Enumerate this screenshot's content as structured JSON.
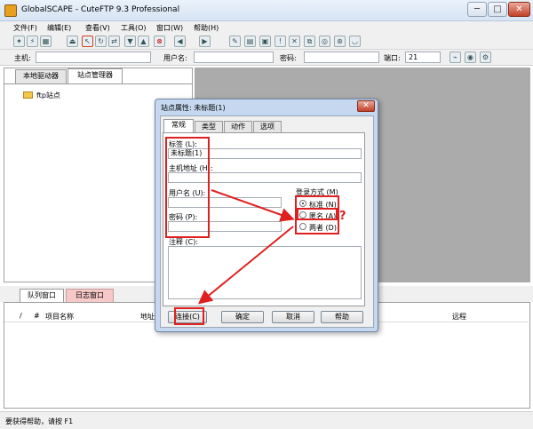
{
  "window": {
    "title": "GlobalSCAPE - CuteFTP 9.3 Professional",
    "minimize": "─",
    "maximize": "□",
    "close": "✕"
  },
  "menu": [
    "文件(F)",
    "编辑(E)",
    "查看(V)",
    "工具(O)",
    "窗口(W)",
    "帮助(H)"
  ],
  "toolbar_icons": [
    "connect-wizard-icon",
    "quick-connect-icon",
    "site-manager-icon",
    "disconnect-icon",
    "folder-icon",
    "select-icon",
    "refresh-icon",
    "reconnect-icon",
    "download-icon",
    "upload-icon",
    "stop-icon",
    "queue-icon",
    "back-icon",
    "forward-icon",
    "edit-icon",
    "view-icon",
    "open-icon",
    "alert-icon",
    "cancel-icon",
    "copy-icon",
    "settings-icon",
    "transfer-icon",
    "help-icon"
  ],
  "quickconnect": {
    "host_label": "主机:",
    "user_label": "用户名:",
    "password_label": "密码:",
    "port_label": "端口:",
    "port_value": "21"
  },
  "left_pane": {
    "tab_local": "本地驱动器",
    "tab_site_manager": "站点管理器",
    "tree_item": "ftp站点"
  },
  "queue": {
    "tab_queue": "队列窗口",
    "tab_log": "日志窗口",
    "columns": [
      "/",
      "#",
      "项目名称",
      "地址",
      "远程"
    ]
  },
  "status": "要获得帮助，请按 F1",
  "dialog": {
    "title": "站点属性: 未标题(1)",
    "close": "✕",
    "tabs": [
      "常规",
      "类型",
      "动作",
      "选项"
    ],
    "label_label": "标签 (L):",
    "label_value": "未标题(1)",
    "host_label": "主机地址 (H):",
    "host_value": "",
    "user_label": "用户名 (U):",
    "user_value": "",
    "password_label": "密码 (P):",
    "password_value": "",
    "login_method_label": "登录方式 (M)",
    "login_options": [
      "标准 (N)",
      "匿名 (A)",
      "两者 (D)"
    ],
    "login_selected": 0,
    "comment_label": "注释 (C):",
    "comment_value": "",
    "buttons": {
      "connect": "连接(C)",
      "ok": "确定",
      "cancel": "取消",
      "help": "帮助"
    },
    "annotation_question": "?"
  },
  "colors": {
    "annotation": "#e02020",
    "right_pane": "#ababab",
    "dialog_frame": "#c5d8ef",
    "log_tab": "#f6c8c8"
  }
}
